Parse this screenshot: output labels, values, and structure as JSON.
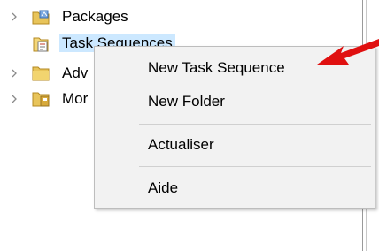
{
  "tree": {
    "items": [
      {
        "label": "Packages",
        "icon": "packages-folder-icon"
      },
      {
        "label": "Task Sequences",
        "icon": "task-sequence-icon",
        "selected": true
      },
      {
        "label": "Adv",
        "icon": "folder-icon"
      },
      {
        "label": "Mor",
        "icon": "monitoring-folder-icon"
      }
    ]
  },
  "context_menu": {
    "items": [
      {
        "label": "New Task Sequence"
      },
      {
        "label": "New Folder"
      },
      {
        "label": "Actualiser"
      },
      {
        "label": "Aide"
      }
    ]
  },
  "annotation": {
    "arrow_color": "#e01010"
  },
  "colors": {
    "selection_bg": "#cce8ff",
    "menu_bg": "#f2f2f2",
    "folder_yellow": "#e8c45a"
  }
}
